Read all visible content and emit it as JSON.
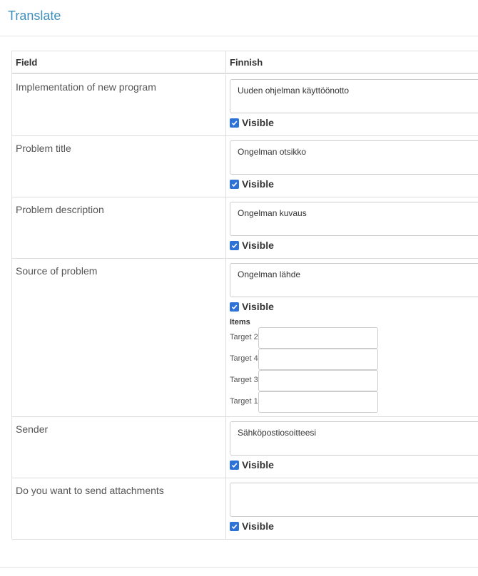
{
  "header": {
    "title": "Translate"
  },
  "table": {
    "columns": {
      "field": "Field",
      "language": "Finnish"
    },
    "rows": [
      {
        "field": "Implementation of new program",
        "value": "Uuden ohjelman käyttöönotto",
        "visible_label": "Visible",
        "visible_checked": true
      },
      {
        "field": "Problem title",
        "value": "Ongelman otsikko",
        "visible_label": "Visible",
        "visible_checked": true
      },
      {
        "field": "Problem description",
        "value": "Ongelman kuvaus",
        "visible_label": "Visible",
        "visible_checked": true
      },
      {
        "field": "Source of problem",
        "value": "Ongelman lähde",
        "visible_label": "Visible",
        "visible_checked": true,
        "items_title": "Items",
        "items": [
          {
            "label": "Target 2",
            "value": ""
          },
          {
            "label": "Target 4",
            "value": ""
          },
          {
            "label": "Target 3",
            "value": ""
          },
          {
            "label": "Target 1",
            "value": ""
          }
        ]
      },
      {
        "field": "Sender",
        "value": "Sähköpostiosoitteesi",
        "visible_label": "Visible",
        "visible_checked": true
      },
      {
        "field": "Do you want to send attachments",
        "value": "",
        "visible_label": "Visible",
        "visible_checked": true
      }
    ]
  },
  "colors": {
    "title": "#3c8dbc",
    "checkbox": "#2f72d6"
  },
  "icons": {
    "checkbox": "check-icon"
  }
}
